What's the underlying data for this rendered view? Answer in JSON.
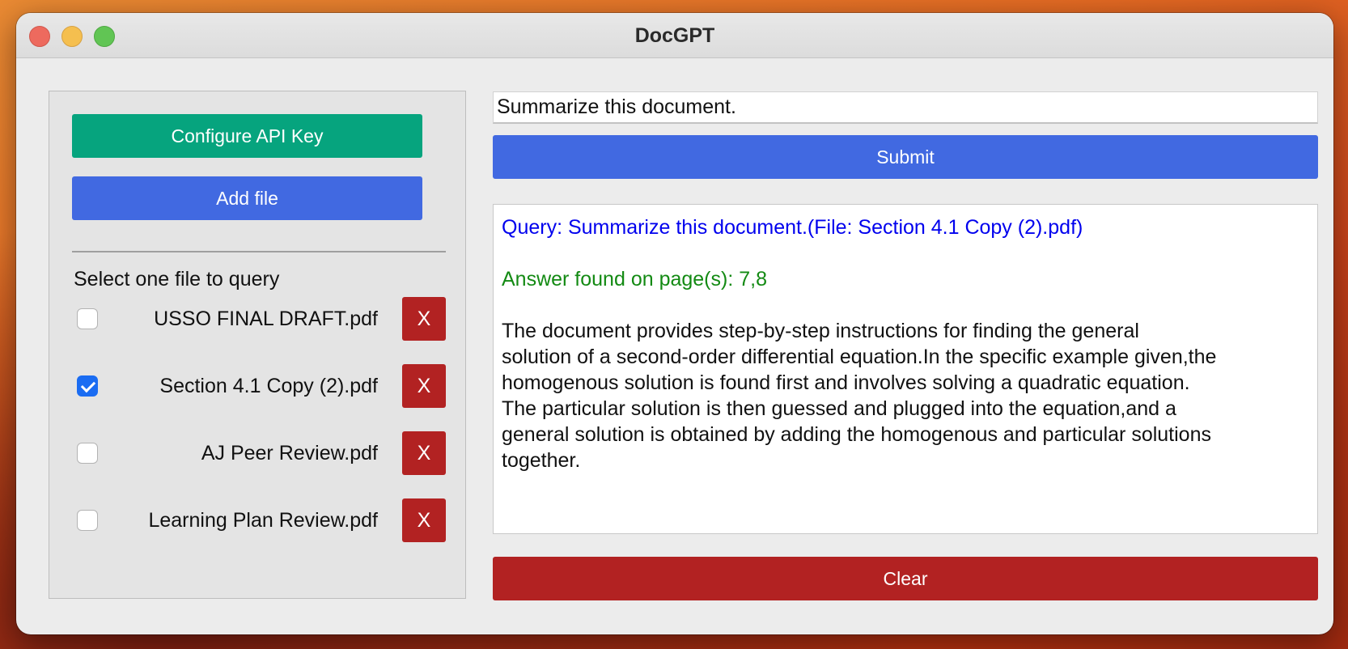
{
  "window": {
    "title": "DocGPT"
  },
  "sidebar": {
    "configure_label": "Configure API Key",
    "add_file_label": "Add file",
    "select_label": "Select one file to query",
    "files": [
      {
        "name": "USSO FINAL DRAFT.pdf",
        "checked": false,
        "remove_label": "X"
      },
      {
        "name": "Section 4.1 Copy (2).pdf",
        "checked": true,
        "remove_label": "X"
      },
      {
        "name": "AJ Peer Review.pdf",
        "checked": false,
        "remove_label": "X"
      },
      {
        "name": "Learning Plan Review.pdf",
        "checked": false,
        "remove_label": "X"
      }
    ]
  },
  "query": {
    "value": "Summarize this document.",
    "submit_label": "Submit",
    "clear_label": "Clear"
  },
  "output": {
    "query_line": "Query: Summarize this document.(File: Section 4.1 Copy (2).pdf)",
    "pages_line": "Answer found on page(s): 7,8",
    "answer_lines": [
      "The document provides step-by-step instructions for finding the general",
      "solution of a second-order differential equation.In the specific example given,the",
      "homogenous solution is found first and involves solving a quadratic equation.",
      "The particular solution is then guessed and plugged into the equation,and a",
      "general solution is obtained by adding the homogenous and particular solutions",
      "together."
    ]
  },
  "colors": {
    "configure_button": "#06a47e",
    "primary_button": "#4169e1",
    "danger_button": "#b22222",
    "query_text": "#0000ee",
    "pages_text": "#138a13",
    "checkbox_checked": "#1a6cf2"
  }
}
